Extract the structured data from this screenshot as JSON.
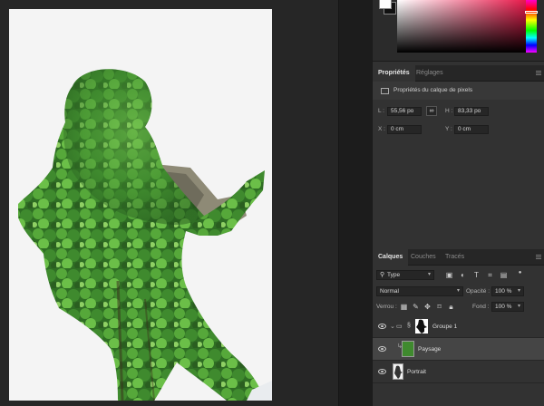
{
  "properties_panel": {
    "tabs": [
      {
        "label": "Propriétés",
        "active": true
      },
      {
        "label": "Réglages",
        "active": false
      }
    ],
    "header_label": "Propriétés du calque de pixels",
    "fields": {
      "L_label": "L :",
      "L_value": "55,56 po",
      "H_label": "H :",
      "H_value": "83,33 po",
      "X_label": "X :",
      "X_value": "0 cm",
      "Y_label": "Y :",
      "Y_value": "0 cm"
    }
  },
  "layers_panel": {
    "tabs": [
      {
        "label": "Calques",
        "active": true
      },
      {
        "label": "Couches",
        "active": false
      },
      {
        "label": "Tracés",
        "active": false
      }
    ],
    "filter_value": "Type",
    "blend_mode": "Normal",
    "opacity_label": "Opacité :",
    "opacity_value": "100 %",
    "lock_label": "Verrou :",
    "fill_label": "Fond :",
    "fill_value": "100 %",
    "layers": [
      {
        "name": "Groupe 1",
        "type": "group",
        "selected": false
      },
      {
        "name": "Paysage",
        "type": "pixel",
        "selected": true
      },
      {
        "name": "Portrait",
        "type": "pixel",
        "selected": false
      }
    ]
  },
  "colors": {
    "panel_bg": "#323232",
    "canvas_bg": "#f4f4f4",
    "foliage": "#3f8a2e",
    "picker_accent": "#e8194a"
  }
}
